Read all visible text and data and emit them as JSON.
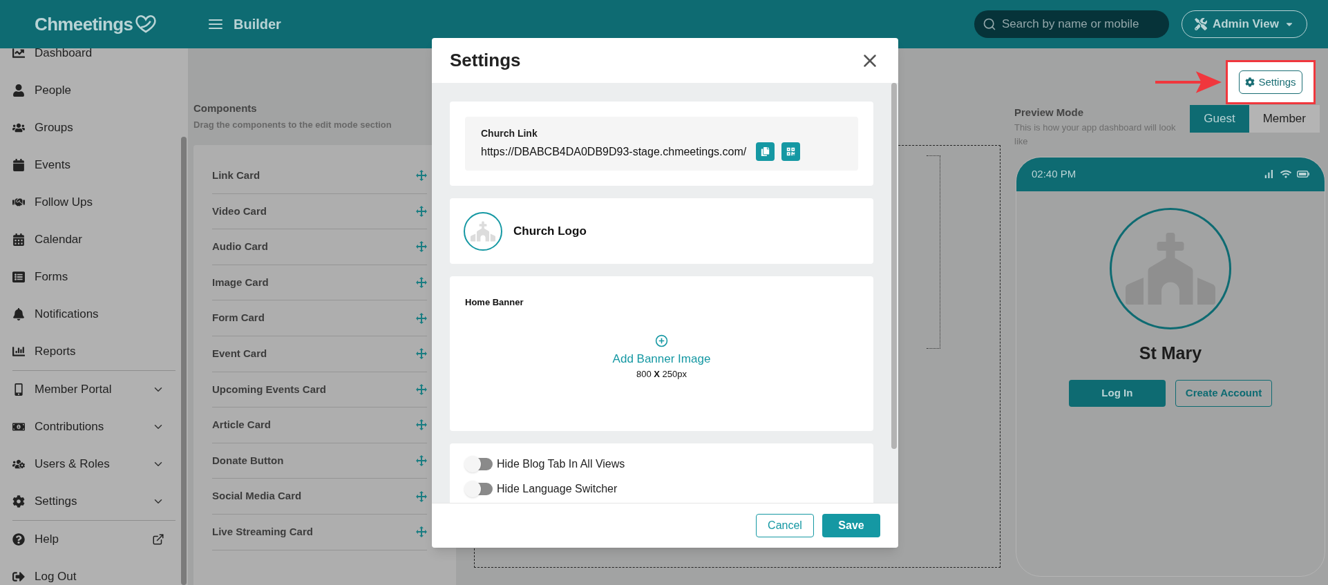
{
  "header": {
    "logo": "Chmeetings",
    "title": "Builder",
    "search": {
      "placeholder": "Search by name or mobile"
    },
    "view_menu": "Admin View"
  },
  "sidebar": {
    "sections": [
      [
        {
          "label": "Dashboard",
          "kind": "link"
        },
        {
          "label": "People",
          "kind": "link"
        },
        {
          "label": "Groups",
          "kind": "link"
        },
        {
          "label": "Events",
          "kind": "link"
        },
        {
          "label": "Follow Ups",
          "kind": "link"
        },
        {
          "label": "Calendar",
          "kind": "link"
        },
        {
          "label": "Forms",
          "kind": "link"
        },
        {
          "label": "Notifications",
          "kind": "link"
        },
        {
          "label": "Reports",
          "kind": "link"
        }
      ],
      [
        {
          "label": "Member Portal",
          "kind": "menu"
        },
        {
          "label": "Contributions",
          "kind": "menu"
        },
        {
          "label": "Users & Roles",
          "kind": "menu"
        },
        {
          "label": "Settings",
          "kind": "menu"
        }
      ],
      [
        {
          "label": "Help",
          "kind": "external"
        },
        {
          "label": "Log Out",
          "kind": "link"
        }
      ]
    ]
  },
  "components": {
    "title": "Components",
    "subtitle": "Drag the components to the edit mode section",
    "items": [
      "Link Card",
      "Video Card",
      "Audio Card",
      "Image Card",
      "Form Card",
      "Event Card",
      "Upcoming Events Card",
      "Article Card",
      "Donate Button",
      "Social Media Card",
      "Live Streaming Card"
    ]
  },
  "toolbar": {
    "settings_button": "Settings"
  },
  "preview": {
    "title": "Preview Mode",
    "subtitle": "This is how your app dashboard will look like",
    "modes": [
      {
        "label": "Guest",
        "selected": true
      },
      {
        "label": "Member",
        "selected": false
      }
    ],
    "phone": {
      "time": "02:40 PM",
      "church_name": "St Mary",
      "buttons": [
        {
          "label": "Log In",
          "kind": "primary"
        },
        {
          "label": "Create Account",
          "kind": "outline"
        }
      ]
    }
  },
  "dialog": {
    "title": "Settings",
    "church_link": {
      "label": "Church Link",
      "url": "https://DBABCB4DA0DB9D93-stage.chmeetings.com/"
    },
    "logo_label": "Church Logo",
    "banner": {
      "label": "Home Banner",
      "action": "Add Banner Image",
      "size": "800 **X** 250px"
    },
    "toggles": [
      {
        "label": "Hide Blog Tab In All Views",
        "on": false
      },
      {
        "label": "Hide Language Switcher",
        "on": false
      }
    ],
    "buttons": [
      {
        "label": "Cancel",
        "kind": "secondary"
      },
      {
        "label": "Save",
        "kind": "primary"
      }
    ]
  }
}
